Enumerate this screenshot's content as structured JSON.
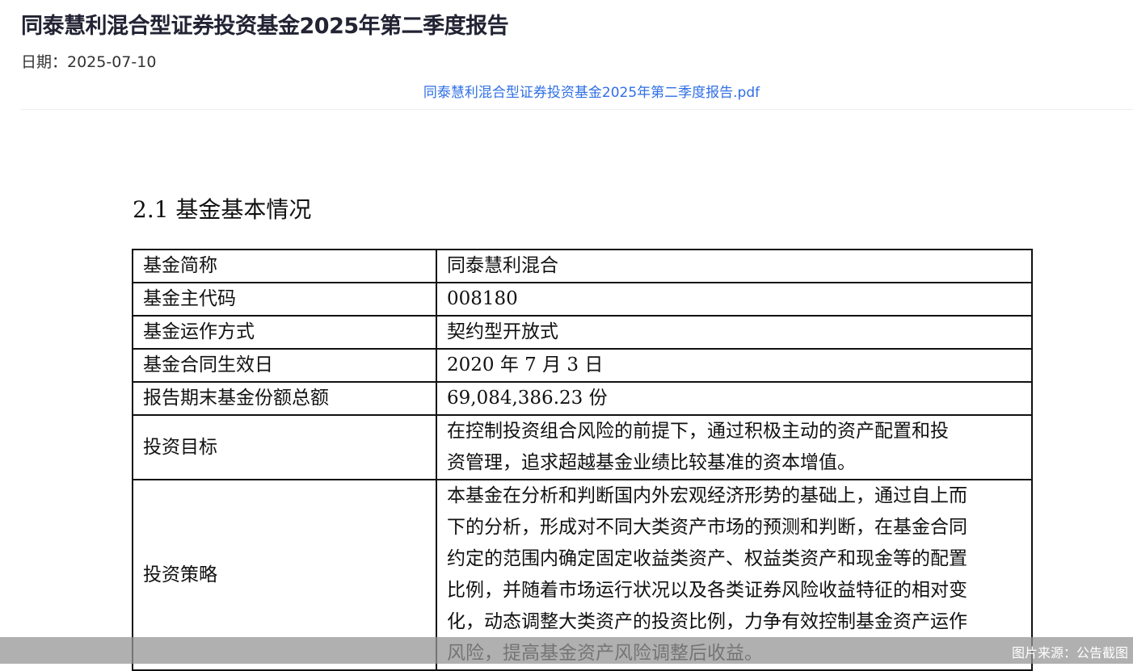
{
  "header": {
    "title": "同泰慧利混合型证券投资基金2025年第二季度报告",
    "date": "日期：2025-07-10",
    "pdf_link": "同泰慧利混合型证券投资基金2025年第二季度报告.pdf"
  },
  "document": {
    "section_heading": "2.1 基金基本情况",
    "rows": [
      {
        "key": "基金简称",
        "lines": [
          "同泰慧利混合"
        ]
      },
      {
        "key": "基金主代码",
        "lines": [
          "008180"
        ]
      },
      {
        "key": "基金运作方式",
        "lines": [
          "契约型开放式"
        ]
      },
      {
        "key": "基金合同生效日",
        "lines": [
          "2020 年 7 月 3 日"
        ]
      },
      {
        "key": "报告期末基金份额总额",
        "lines": [
          "69,084,386.23 份"
        ]
      },
      {
        "key": "投资目标",
        "lines": [
          "在控制投资组合风险的前提下，通过积极主动的资产配置和投",
          "资管理，追求超越基金业绩比较基准的资本增值。"
        ]
      },
      {
        "key": "投资策略",
        "lines": [
          "本基金在分析和判断国内外宏观经济形势的基础上，通过自上而",
          "下的分析，形成对不同大类资产市场的预测和判断，在基金合同",
          "约定的范围内确定固定收益类资产、权益类资产和现金等的配置",
          "比例，并随着市场运行状况以及各类证券风险收益特征的相对变",
          "化，动态调整大类资产的投资比例，力争有效控制基金资产运作",
          "风险，提高基金资产风险调整后收益。"
        ]
      }
    ]
  },
  "footer": {
    "source": "图片来源：公告截图"
  }
}
